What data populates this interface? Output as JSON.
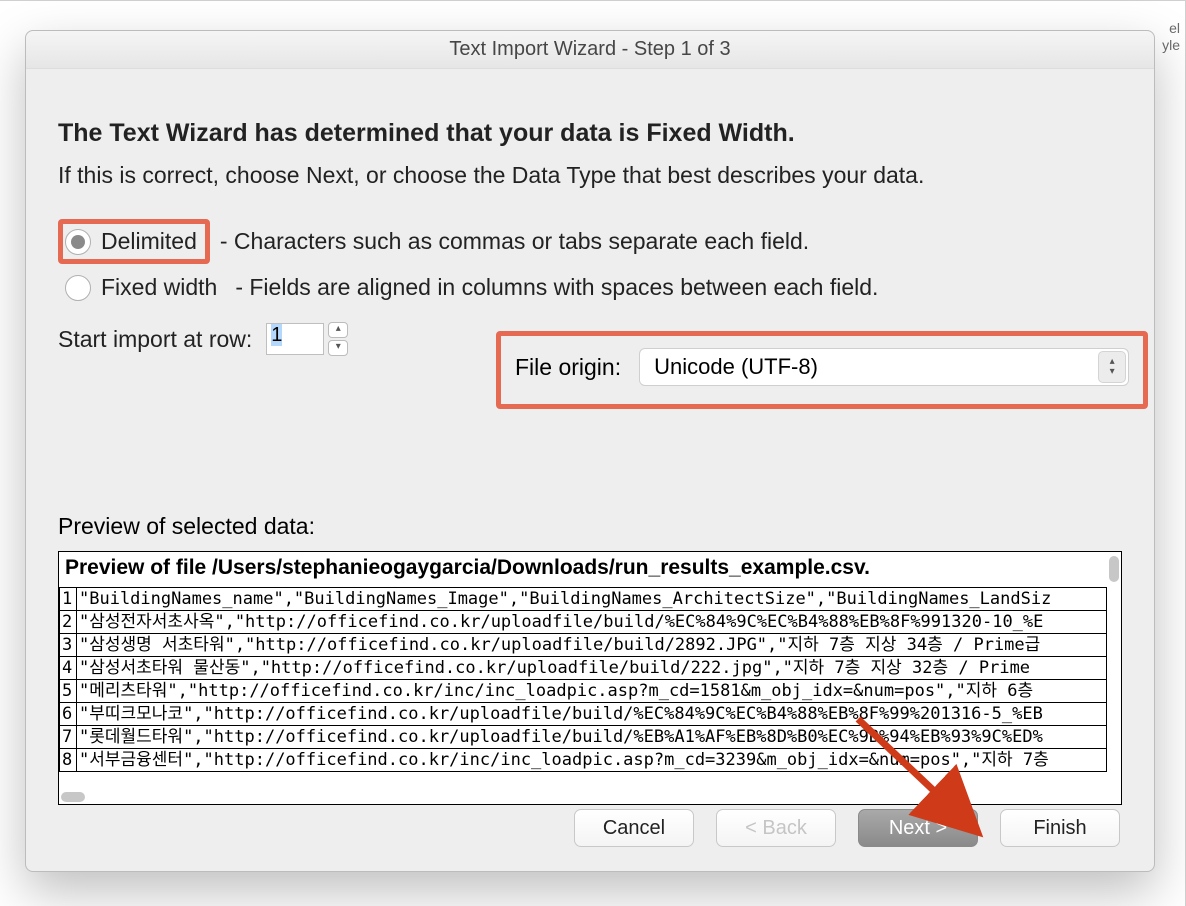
{
  "background": {
    "rightTopText": "el\nyle"
  },
  "dialog": {
    "title": "Text Import Wizard - Step 1 of 3",
    "heading": "The Text Wizard has determined that your data is Fixed Width.",
    "subtext": "If this is correct, choose Next, or choose the Data Type that best describes your data.",
    "options": {
      "delimited": {
        "label": "Delimited",
        "desc": "- Characters such as commas or tabs separate each field.",
        "selected": true
      },
      "fixedWidth": {
        "label": "Fixed width",
        "desc": "- Fields are aligned in columns with spaces between each field.",
        "selected": false
      }
    },
    "startImport": {
      "label": "Start import at row:",
      "value": "1"
    },
    "fileOrigin": {
      "label": "File origin:",
      "selected": "Unicode (UTF-8)"
    },
    "preview": {
      "label": "Preview of selected data:",
      "header": "Preview of file /Users/stephanieogaygarcia/Downloads/run_results_example.csv.",
      "lines": [
        {
          "n": "1",
          "t": "\"BuildingNames_name\",\"BuildingNames_Image\",\"BuildingNames_ArchitectSize\",\"BuildingNames_LandSiz"
        },
        {
          "n": "2",
          "t": "\"삼성전자서초사옥\",\"http://officefind.co.kr/uploadfile/build/%EC%84%9C%EC%B4%88%EB%8F%991320-10_%E"
        },
        {
          "n": "3",
          "t": "\"삼성생명 서초타워\",\"http://officefind.co.kr/uploadfile/build/2892.JPG\",\"지하 7층 지상 34층 / Prime급"
        },
        {
          "n": "4",
          "t": "\"삼성서초타워 물산동\",\"http://officefind.co.kr/uploadfile/build/222.jpg\",\"지하 7층 지상 32층 / Prime"
        },
        {
          "n": "5",
          "t": "\"메리츠타워\",\"http://officefind.co.kr/inc/inc_loadpic.asp?m_cd=1581&m_obj_idx=&num=pos\",\"지하 6층"
        },
        {
          "n": "6",
          "t": "\"부띠크모나코\",\"http://officefind.co.kr/uploadfile/build/%EC%84%9C%EC%B4%88%EB%8F%99%201316-5_%EB"
        },
        {
          "n": "7",
          "t": "\"롯데월드타워\",\"http://officefind.co.kr/uploadfile/build/%EB%A1%AF%EB%8D%B0%EC%9B%94%EB%93%9C%ED%"
        },
        {
          "n": "8",
          "t": "\"서부금융센터\",\"http://officefind.co.kr/inc/inc_loadpic.asp?m_cd=3239&m_obj_idx=&num=pos\",\"지하 7층"
        }
      ]
    },
    "buttons": {
      "cancel": "Cancel",
      "back": "< Back",
      "next": "Next >",
      "finish": "Finish"
    }
  },
  "annotation": {
    "arrowColor": "#cf3a18"
  }
}
